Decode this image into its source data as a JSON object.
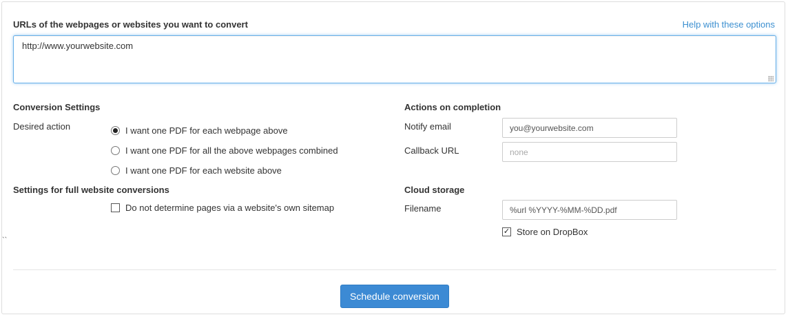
{
  "urls": {
    "label": "URLs of the webpages or websites you want to convert",
    "help_link": "Help with these options",
    "value": "http://www.yourwebsite.com"
  },
  "conversion_settings": {
    "title": "Conversion Settings",
    "desired_action_label": "Desired action",
    "options": [
      {
        "label": "I want one PDF for each webpage above",
        "checked": true
      },
      {
        "label": "I want one PDF for all the above webpages combined",
        "checked": false
      },
      {
        "label": "I want one PDF for each website above",
        "checked": false
      }
    ]
  },
  "full_website": {
    "title": "Settings for full website conversions",
    "sitemap_checkbox_label": "Do not determine pages via a website's own sitemap",
    "sitemap_checked": false
  },
  "actions_on_completion": {
    "title": "Actions on completion",
    "notify_email_label": "Notify email",
    "notify_email_value": "you@yourwebsite.com",
    "callback_url_label": "Callback URL",
    "callback_url_placeholder": "none"
  },
  "cloud_storage": {
    "title": "Cloud storage",
    "filename_label": "Filename",
    "filename_value": "%url %YYYY-%MM-%DD.pdf",
    "dropbox_label": "Store on DropBox",
    "dropbox_checked": true,
    "check_glyph": "✓"
  },
  "stray_mark": "``",
  "schedule_button": "Schedule conversion",
  "colors": {
    "accent": "#3c8ad4",
    "link": "#3b8fd0",
    "focus_border": "#66afe9"
  }
}
